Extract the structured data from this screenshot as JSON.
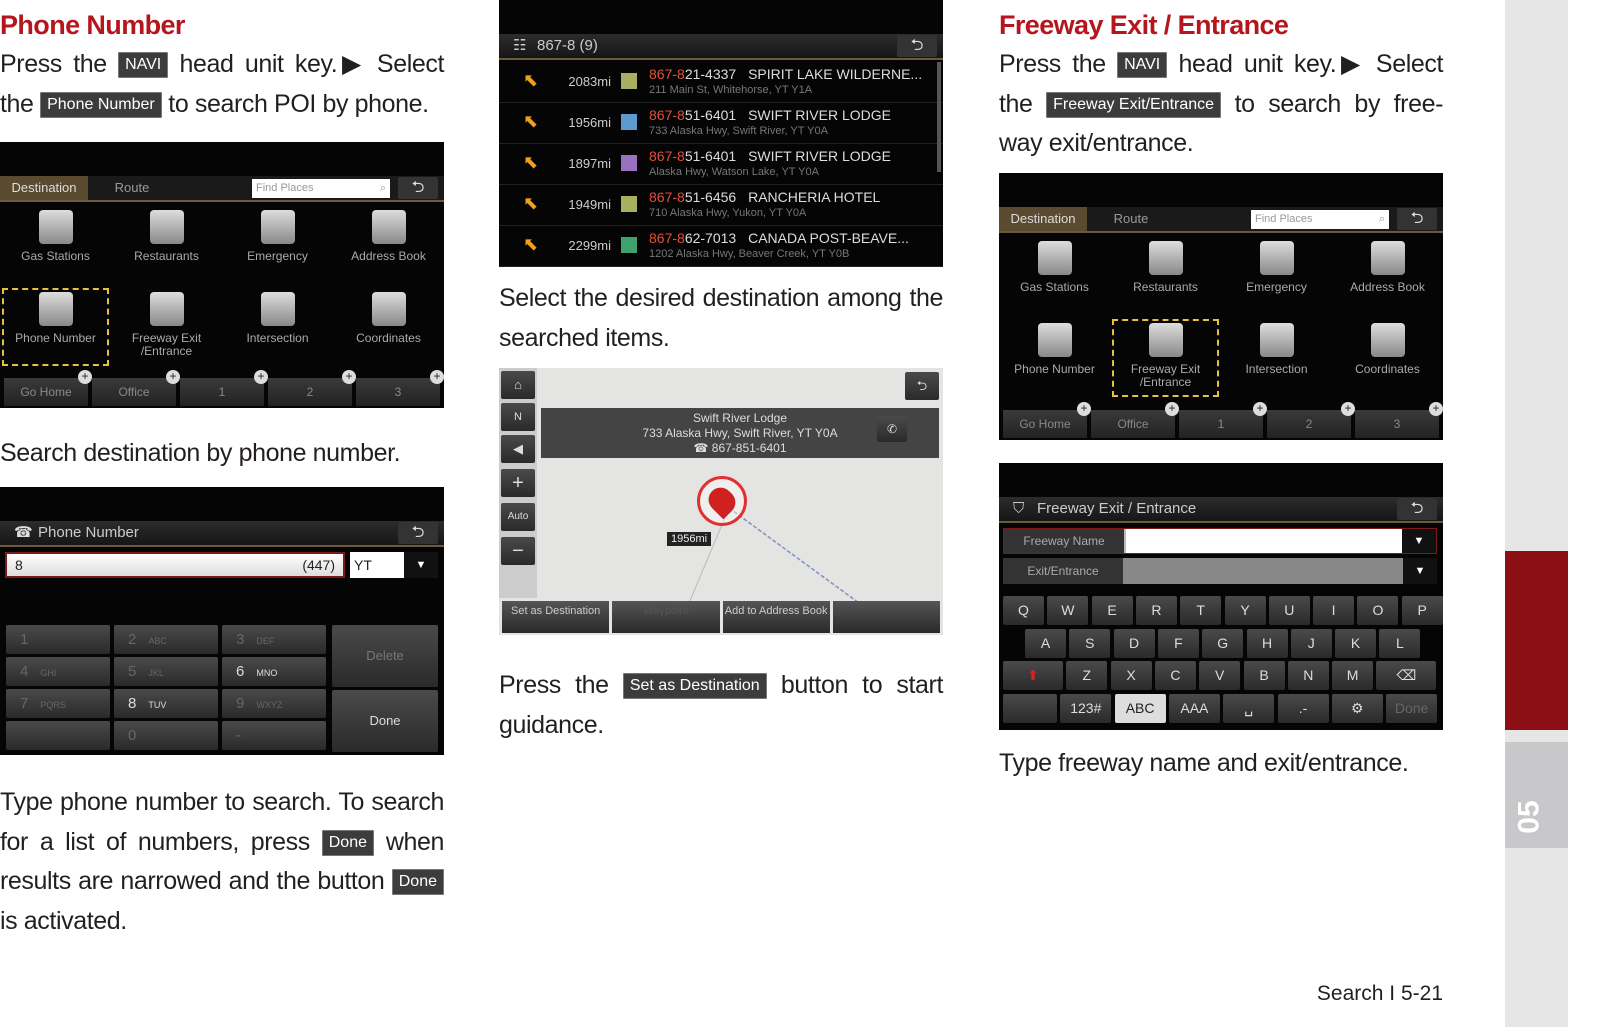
{
  "left": {
    "title": "Phone Number",
    "p1": {
      "t1": "Press the",
      "btn1": "NAVI",
      "t2": "head unit key.▶ Select the",
      "btn2": "Phone Number",
      "t3": "to search POI by phone."
    },
    "caption1": "Search destination by phone number.",
    "p2": {
      "t1": "Type phone number to search. To search for a list of numbers, press",
      "btn1": "Done",
      "t2": "when results are narrowed and the button",
      "btn2": "Done",
      "t3": "is activated."
    }
  },
  "middle": {
    "p1": "Select the desired destination among the searched items.",
    "p2": {
      "t1": "Press the",
      "btn": "Set as Destination",
      "t2": "button to start guidance."
    }
  },
  "right": {
    "title": "Freeway Exit / Entrance",
    "p1": {
      "t1": "Press the",
      "btn1": "NAVI",
      "t2": "head unit key.▶ Select the",
      "btn2": "Freeway Exit/Entrance",
      "t3": "to search by free-way exit/entrance."
    },
    "caption": "Type freeway name and exit/entrance."
  },
  "dest_menu": {
    "tabs": [
      "Destination",
      "Route"
    ],
    "search_placeholder": "Find Places",
    "items": [
      "Gas Stations",
      "Restaurants",
      "Emergency",
      "Address Book",
      "Phone Number",
      "Freeway Exit /Entrance",
      "Intersection",
      "Coordinates"
    ],
    "bottom": [
      "Go Home",
      "Office",
      "1",
      "2",
      "3"
    ]
  },
  "phone_screen": {
    "title": "Phone Number",
    "input": "8",
    "area_code": "(447)",
    "state": "YT",
    "keys": [
      [
        "1",
        ""
      ],
      [
        "2",
        "ABC"
      ],
      [
        "3",
        "DEF"
      ],
      [
        "4",
        "GHI"
      ],
      [
        "5",
        "JKL"
      ],
      [
        "6",
        "MNO"
      ],
      [
        "7",
        "PQRS"
      ],
      [
        "8",
        "TUV"
      ],
      [
        "9",
        "WXYZ"
      ],
      [
        "",
        ""
      ],
      [
        "0",
        ""
      ],
      [
        "-",
        ""
      ]
    ],
    "delete": "Delete",
    "done": "Done"
  },
  "results": {
    "title": "867-8 (9)",
    "items": [
      {
        "dist": "2083mi",
        "prefix": "867-8",
        "phone": "21-4337",
        "name": "SPIRIT LAKE WILDERNE...",
        "addr": "211 Main St, Whitehorse, YT Y1A",
        "color": "#a8b060"
      },
      {
        "dist": "1956mi",
        "prefix": "867-8",
        "phone": "51-6401",
        "name": "SWIFT RIVER LODGE",
        "addr": "733 Alaska Hwy, Swift River, YT Y0A",
        "color": "#5a9ad0"
      },
      {
        "dist": "1897mi",
        "prefix": "867-8",
        "phone": "51-6401",
        "name": "SWIFT RIVER LODGE",
        "addr": "Alaska Hwy, Watson Lake, YT Y0A",
        "color": "#9a70c0"
      },
      {
        "dist": "1949mi",
        "prefix": "867-8",
        "phone": "51-6456",
        "name": "RANCHERIA HOTEL",
        "addr": "710 Alaska Hwy, Yukon, YT Y0A",
        "color": "#a8b060"
      },
      {
        "dist": "2299mi",
        "prefix": "867-8",
        "phone": "62-7013",
        "name": "CANADA POST-BEAVE...",
        "addr": "1202 Alaska Hwy, Beaver Creek, YT Y0B",
        "color": "#40a070"
      }
    ]
  },
  "map": {
    "name": "Swift River Lodge",
    "addr": "733 Alaska Hwy, Swift River, YT Y0A",
    "phone": "867-851-6401",
    "distance": "1956mi",
    "buttons": [
      "Set as Destination",
      "Waypoint",
      "Add to Address Book",
      ""
    ]
  },
  "freeway_screen": {
    "title": "Freeway Exit / Entrance",
    "field1": "Freeway Name",
    "field2": "Exit/Entrance",
    "rows": [
      [
        "Q",
        "W",
        "E",
        "R",
        "T",
        "Y",
        "U",
        "I",
        "O",
        "P"
      ],
      [
        "A",
        "S",
        "D",
        "F",
        "G",
        "H",
        "J",
        "K",
        "L"
      ],
      [
        "⬆",
        "Z",
        "X",
        "C",
        "V",
        "B",
        "N",
        "M",
        "⌫"
      ],
      [
        "",
        "123#",
        "ABC",
        "AAA",
        "␣",
        ".-",
        "⚙",
        "Done"
      ]
    ]
  },
  "footer": {
    "section": "Search",
    "page": "5-21"
  },
  "chapter": "05",
  "colors": {
    "heading": "#b5161d",
    "chapter_tab": "#8b0f14",
    "phone_prefix": "#e0503a"
  }
}
